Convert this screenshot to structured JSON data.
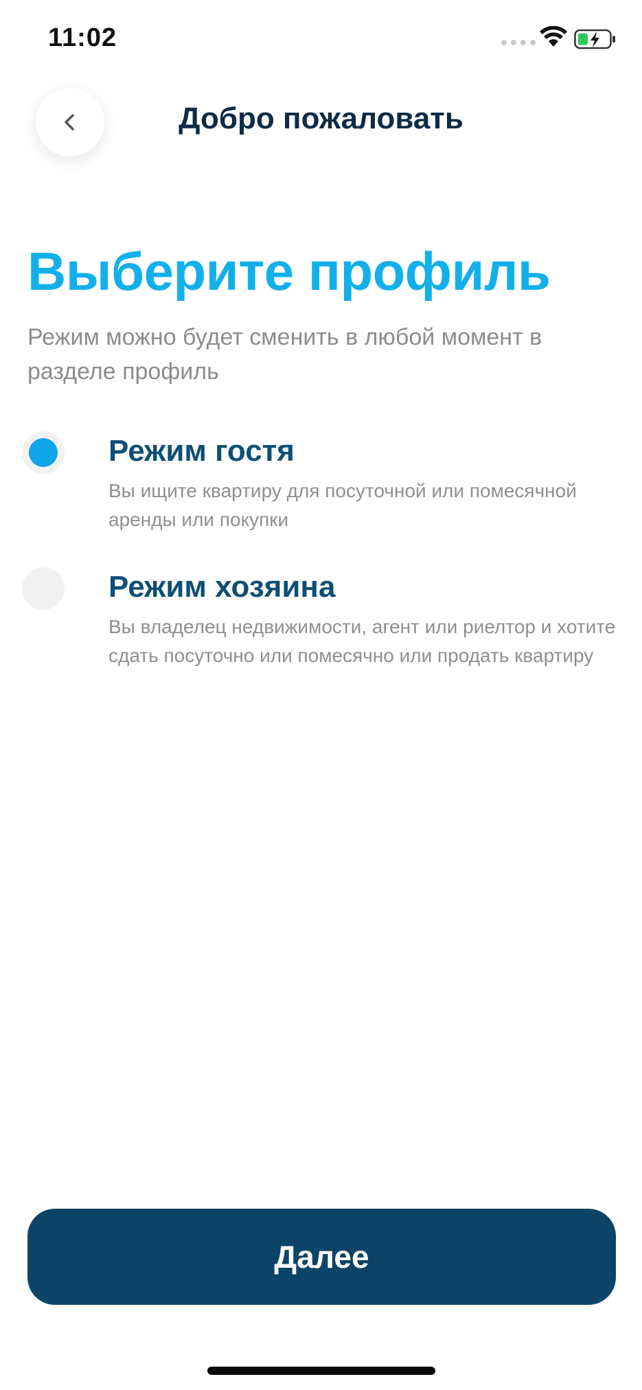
{
  "status_bar": {
    "time": "11:02",
    "icons": [
      "signal-dots-icon",
      "wifi-icon",
      "battery-charging-icon"
    ],
    "battery_color": "#34c759"
  },
  "header": {
    "back_icon": "chevron-left-icon",
    "title": "Добро пожаловать"
  },
  "main": {
    "title": "Выберите профиль",
    "subtitle": "Режим можно будет сменить в любой момент в разделе профиль",
    "options": [
      {
        "title": "Режим гостя",
        "description": "Вы ищите квартиру для посуточной или помесячной аренды или покупки",
        "selected": true
      },
      {
        "title": "Режим хозяина",
        "description": "Вы владелец недвижимости, агент или риелтор и хотите сдать посуточно или помесячно или продать квартиру",
        "selected": false
      }
    ]
  },
  "footer": {
    "next_label": "Далее"
  },
  "colors": {
    "accent": "#12b0ea",
    "radio_selected": "#0ea5e9",
    "option_title": "#0d4f74",
    "primary_button": "#0c4468",
    "header_title": "#0f2b45",
    "muted_text": "#8c8c8c"
  }
}
